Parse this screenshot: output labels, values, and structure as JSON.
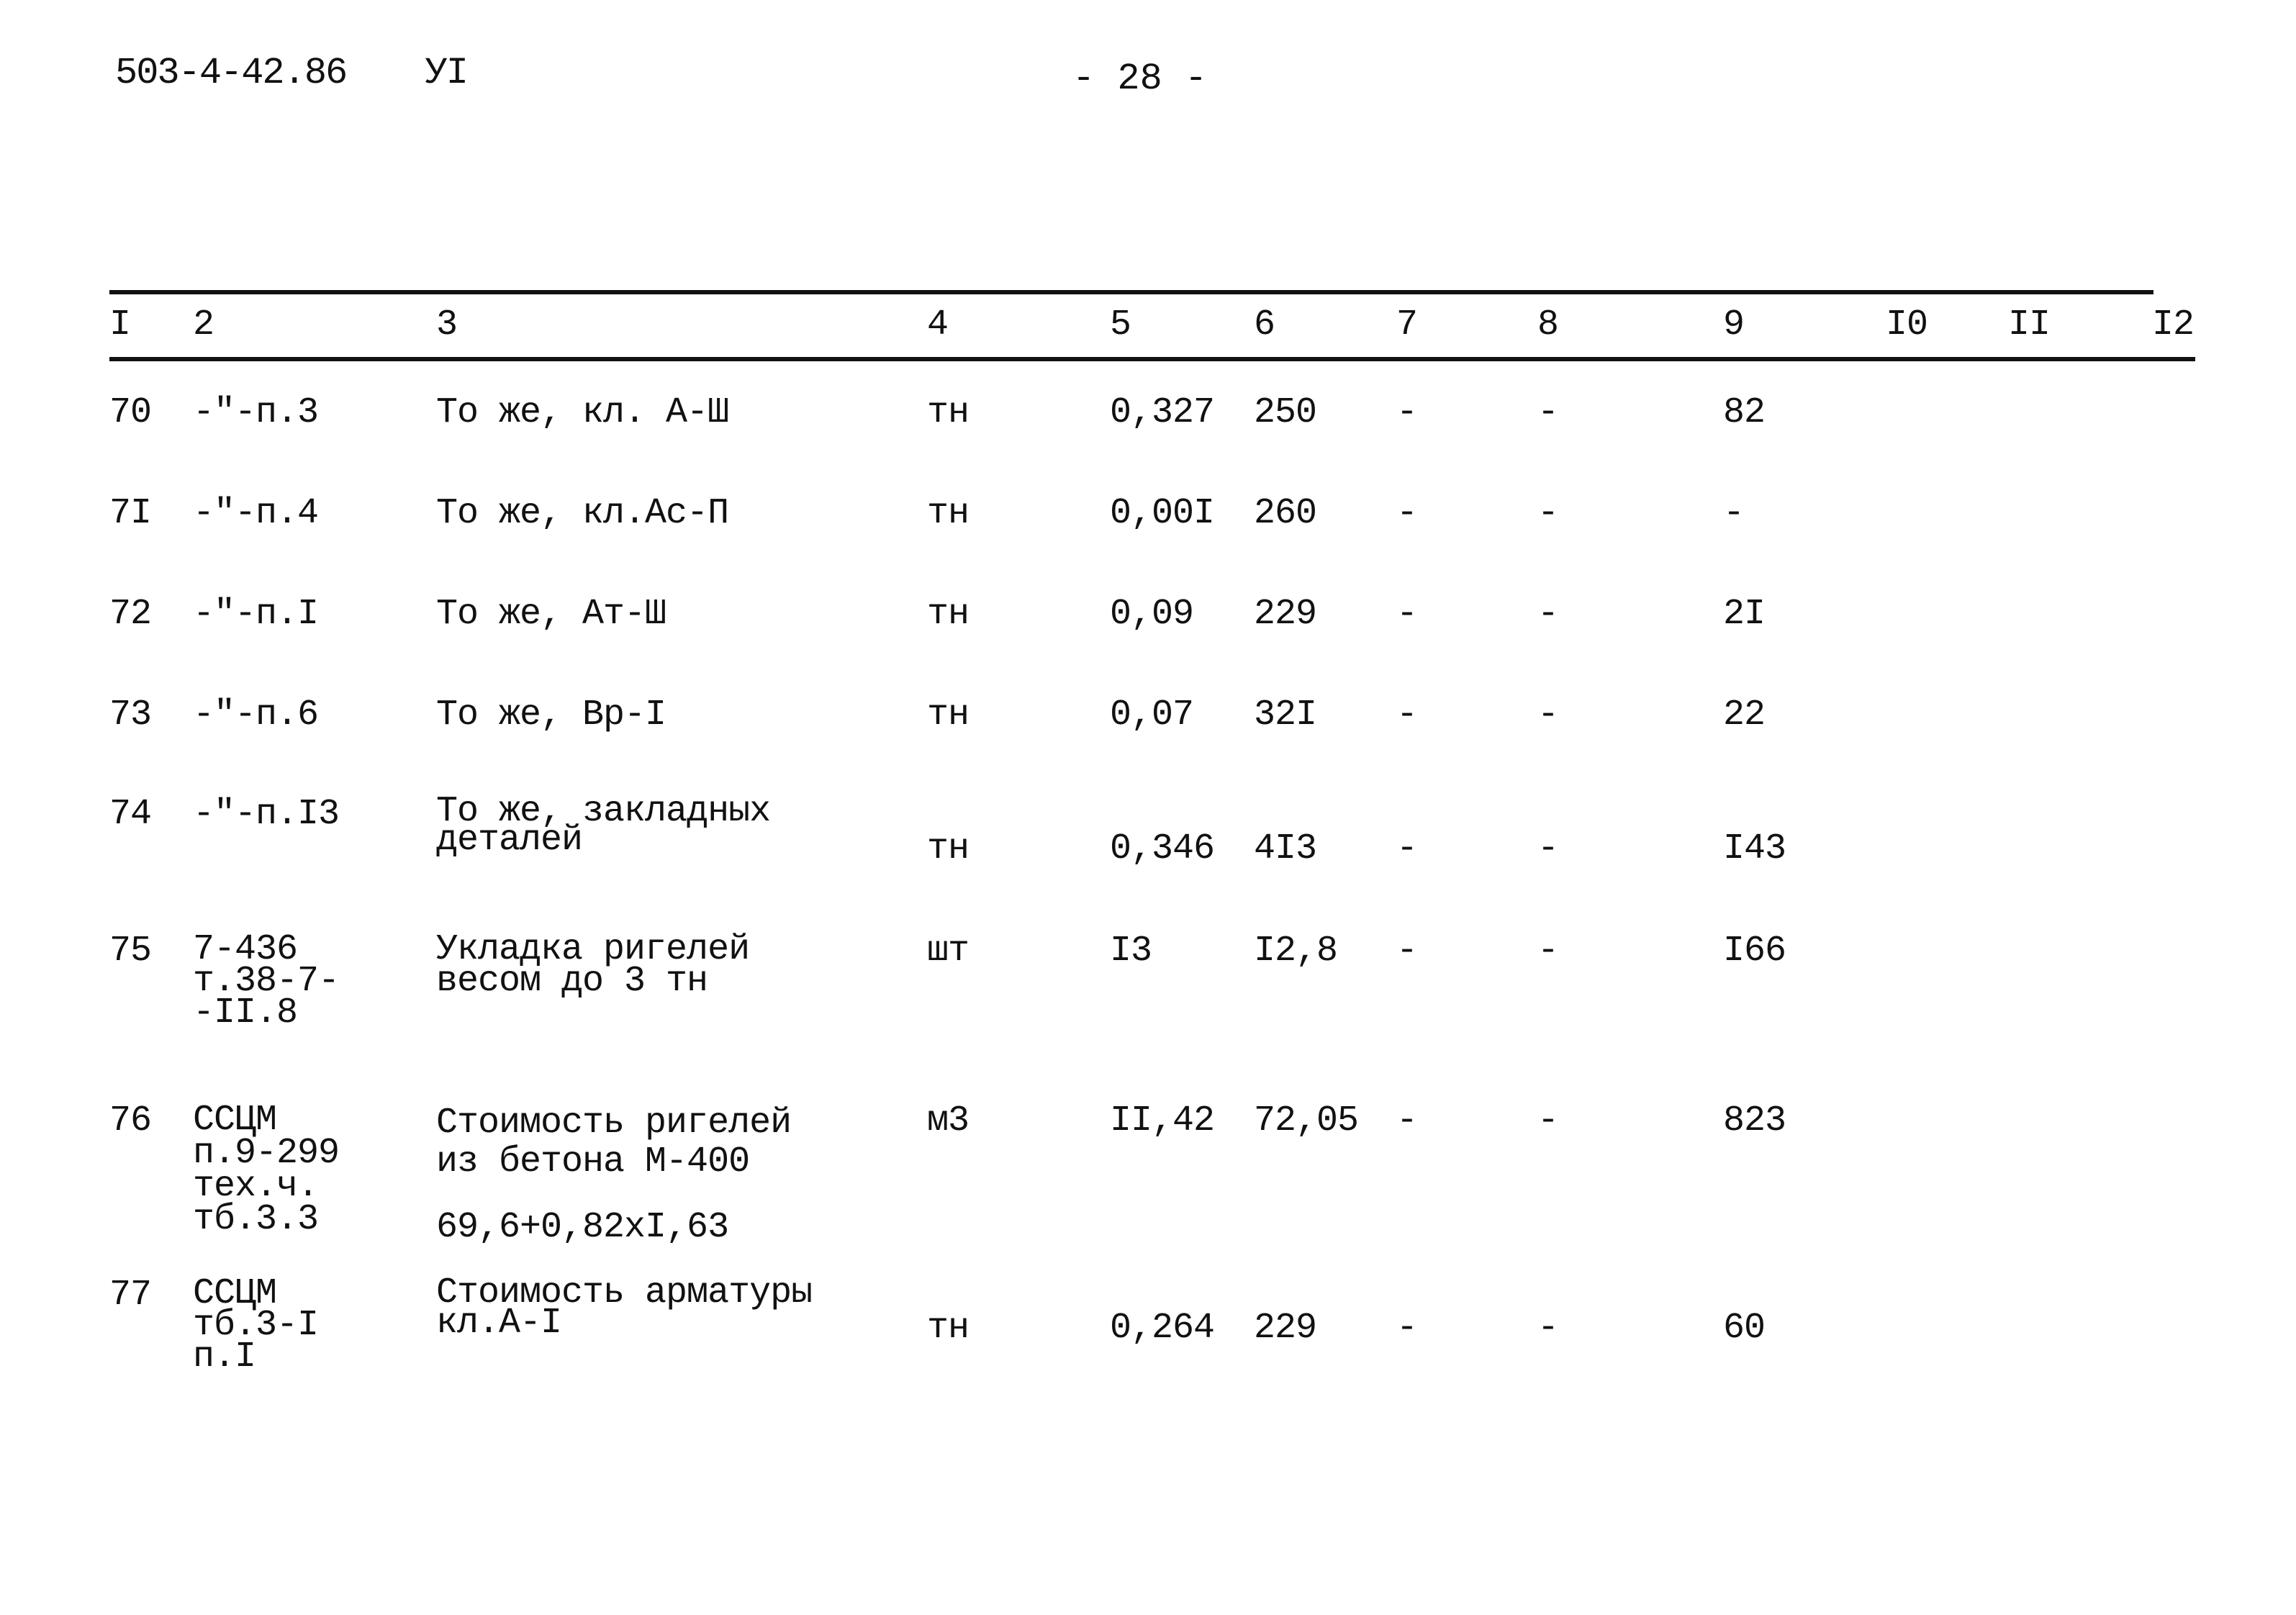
{
  "header": {
    "series": "503-4-42.86",
    "section": "УI",
    "page_number": "- 28 -"
  },
  "table": {
    "columns": [
      "I",
      "2",
      "3",
      "4",
      "5",
      "6",
      "7",
      "8",
      "9",
      "I0",
      "II",
      "I2"
    ],
    "rows": [
      {
        "no": "70",
        "ref": "-\"-п.3",
        "description": "То же, кл. А-Ш",
        "unit": "тн",
        "qty": "0,327",
        "price": "250",
        "c7": "-",
        "c8": "-",
        "c9": "82"
      },
      {
        "no": "7I",
        "ref": "-\"-п.4",
        "description": "То же, кл.Ас-П",
        "unit": "тн",
        "qty": "0,00I",
        "price": "260",
        "c7": "-",
        "c8": "-",
        "c9": "-"
      },
      {
        "no": "72",
        "ref": "-\"-п.I",
        "description": "То же, Ат-Ш",
        "unit": "тн",
        "qty": "0,09",
        "price": "229",
        "c7": "-",
        "c8": "-",
        "c9": "2I"
      },
      {
        "no": "73",
        "ref": "-\"-п.6",
        "description": "То же, Вр-I",
        "unit": "тн",
        "qty": "0,07",
        "price": "32I",
        "c7": "-",
        "c8": "-",
        "c9": "22"
      },
      {
        "no": "74",
        "ref": "-\"-п.I3",
        "description": "То же, закладных\nдеталей",
        "unit": "тн",
        "qty": "0,346",
        "price": "4I3",
        "c7": "-",
        "c8": "-",
        "c9": "I43"
      },
      {
        "no": "75",
        "ref": "7-436\nт.38-7-\n-II.8",
        "description": "Укладка ригелей\nвесом до 3 тн",
        "unit": "шт",
        "qty": "I3",
        "price": "I2,8",
        "c7": "-",
        "c8": "-",
        "c9": "I66"
      },
      {
        "no": "76",
        "ref": "ССЦМ\nп.9-299\nтех.ч.\nтб.3.3",
        "description": "Стоимость ригелей\nиз бетона М-400",
        "formula": "69,6+0,82хI,63",
        "unit": "м3",
        "qty": "II,42",
        "price": "72,05",
        "c7": "-",
        "c8": "-",
        "c9": "823"
      },
      {
        "no": "77",
        "ref": "ССЦМ\nтб.3-I\nп.I",
        "description": "Стоимость арматуры\nкл.А-I",
        "unit": "тн",
        "qty": "0,264",
        "price": "229",
        "c7": "-",
        "c8": "-",
        "c9": "60"
      }
    ]
  }
}
